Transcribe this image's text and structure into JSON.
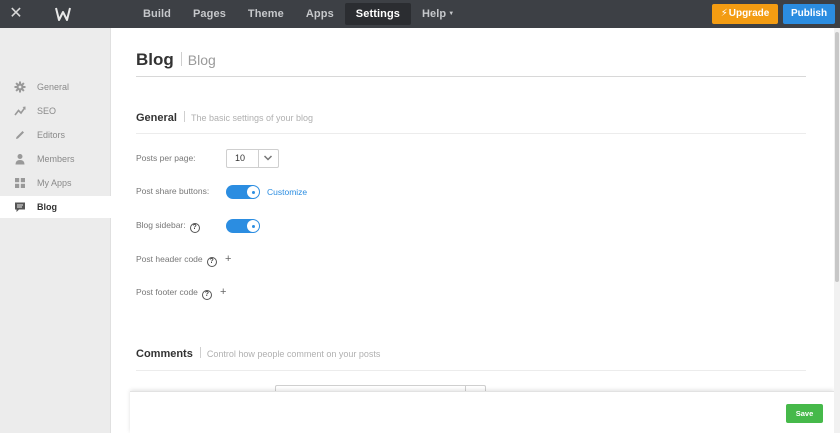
{
  "topbar": {
    "nav": [
      {
        "label": "Build",
        "active": false
      },
      {
        "label": "Pages",
        "active": false
      },
      {
        "label": "Theme",
        "active": false
      },
      {
        "label": "Apps",
        "active": false
      },
      {
        "label": "Settings",
        "active": true
      },
      {
        "label": "Help",
        "active": false
      }
    ],
    "upgrade_label": "Upgrade",
    "publish_label": "Publish",
    "colors": {
      "bar": "#3d4045",
      "upgrade": "#f39c12",
      "publish": "#2b8de1"
    }
  },
  "sidebar": {
    "items": [
      {
        "label": "General",
        "icon": "gear-icon",
        "active": false
      },
      {
        "label": "SEO",
        "icon": "trend-icon",
        "active": false
      },
      {
        "label": "Editors",
        "icon": "pencil-icon",
        "active": false
      },
      {
        "label": "Members",
        "icon": "person-icon",
        "active": false
      },
      {
        "label": "My Apps",
        "icon": "apps-grid-icon",
        "active": false
      },
      {
        "label": "Blog",
        "icon": "comment-icon",
        "active": true
      }
    ]
  },
  "main": {
    "title": "Blog",
    "subtitle": "Blog",
    "general": {
      "title": "General",
      "description": "The basic settings of your blog",
      "posts_per_page": {
        "label": "Posts per page:",
        "value": "10"
      },
      "post_share_buttons": {
        "label": "Post share buttons:",
        "enabled": true,
        "link": "Customize"
      },
      "blog_sidebar": {
        "label": "Blog sidebar:",
        "enabled": true
      },
      "post_header_code": {
        "label": "Post header code"
      },
      "post_footer_code": {
        "label": "Post footer code"
      }
    },
    "comments": {
      "title": "Comments",
      "description": "Control how people comment on your posts"
    }
  },
  "savebar": {
    "save_label": "Save",
    "color": "#46b94a"
  }
}
